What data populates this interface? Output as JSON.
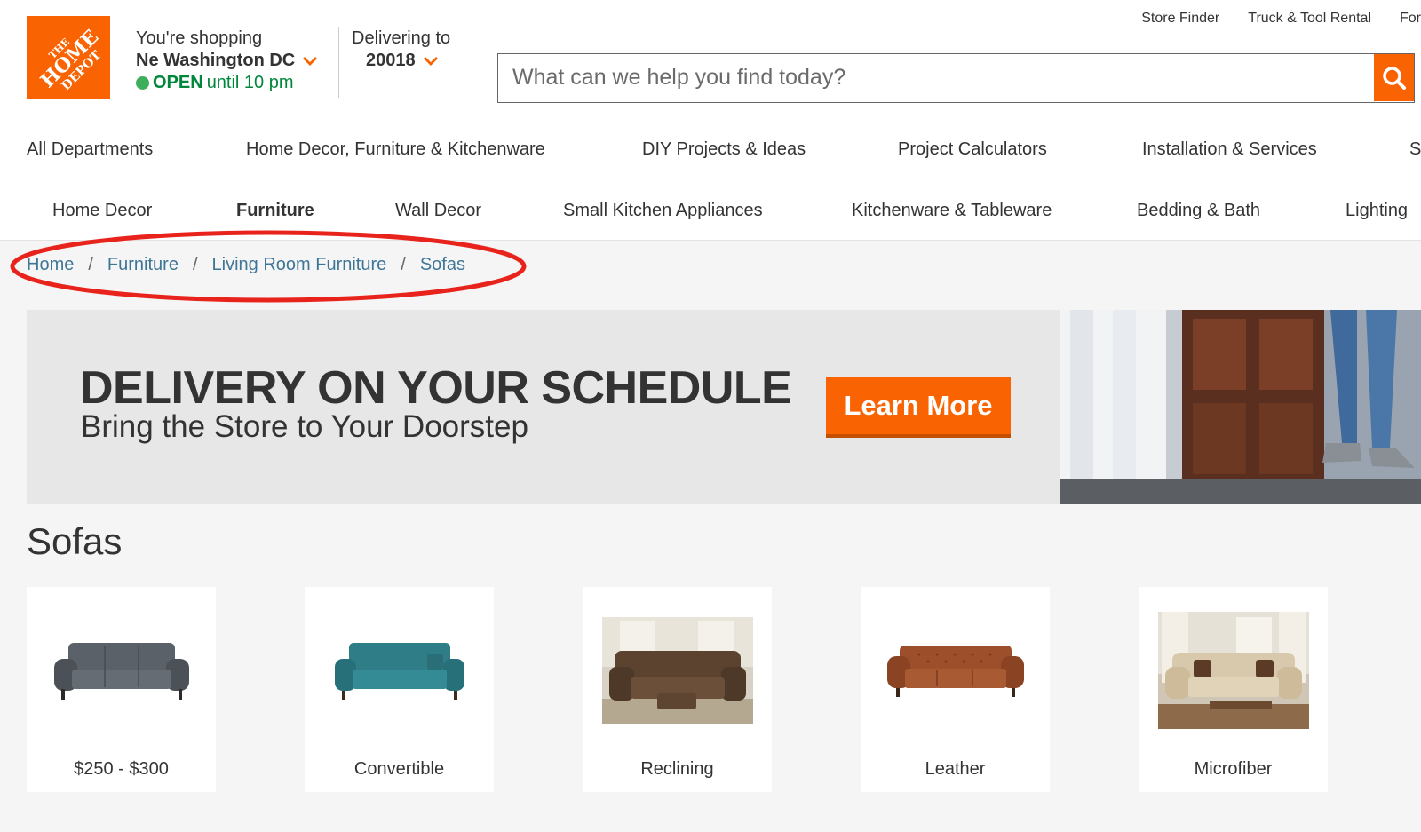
{
  "header": {
    "logo_text": "THE HOME DEPOT",
    "store": {
      "prefix": "You're shopping",
      "name": "Ne Washington DC",
      "status": "OPEN",
      "hours": "until 10 pm"
    },
    "delivery": {
      "label": "Delivering to",
      "zip": "20018"
    },
    "top_links": [
      "Store Finder",
      "Truck & Tool Rental",
      "For"
    ],
    "search": {
      "placeholder": "What can we help you find today?"
    }
  },
  "main_nav": [
    "All Departments",
    "Home Decor, Furniture & Kitchenware",
    "DIY Projects & Ideas",
    "Project Calculators",
    "Installation & Services",
    "S"
  ],
  "sub_nav": [
    "Home Decor",
    "Furniture",
    "Wall Decor",
    "Small Kitchen Appliances",
    "Kitchenware & Tableware",
    "Bedding & Bath",
    "Lighting"
  ],
  "breadcrumb": [
    "Home",
    "Furniture",
    "Living Room Furniture",
    "Sofas"
  ],
  "banner": {
    "headline": "DELIVERY ON YOUR SCHEDULE",
    "subline": "Bring the Store to Your Doorstep",
    "cta": "Learn More"
  },
  "page_title": "Sofas",
  "categories": [
    "$250 - $300",
    "Convertible",
    "Reclining",
    "Leather",
    "Microfiber"
  ],
  "colors": {
    "brand_orange": "#f96302",
    "open_green": "#00873c",
    "link_blue": "#3e7697",
    "annotation_red": "#e8231c"
  }
}
